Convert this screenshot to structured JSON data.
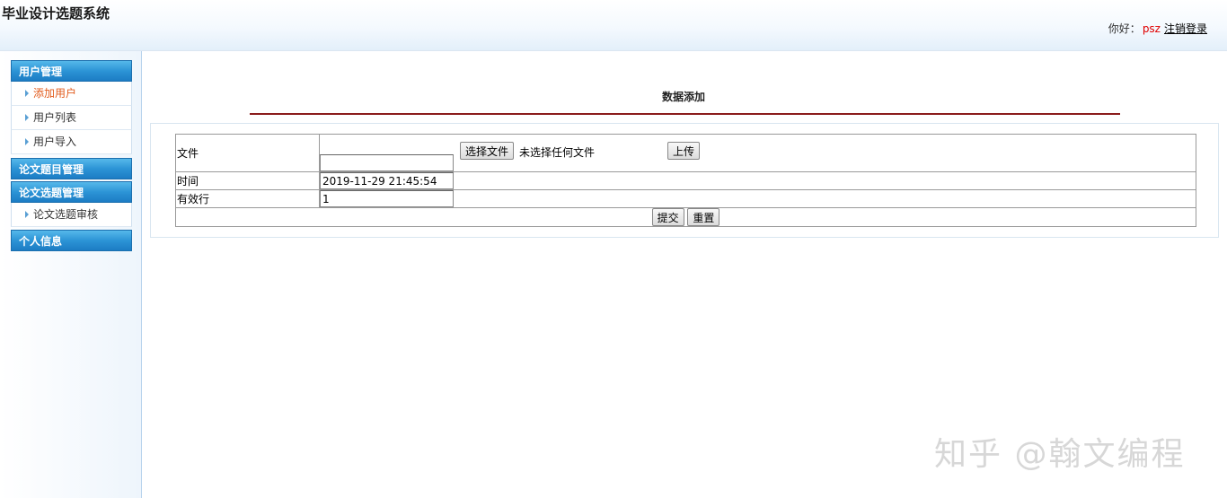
{
  "header": {
    "app_title": "毕业设计选题系统",
    "greeting": "你好：",
    "username": "psz",
    "logout": "注销登录"
  },
  "sidebar": {
    "groups": [
      {
        "title": "用户管理",
        "items": [
          "添加用户",
          "用户列表",
          "用户导入"
        ]
      },
      {
        "title": "论文题目管理",
        "items": []
      },
      {
        "title": "论文选题管理",
        "items": [
          "论文选题审核"
        ]
      },
      {
        "title": "个人信息",
        "items": []
      }
    ],
    "active_item": "添加用户"
  },
  "main": {
    "page_title": "数据添加",
    "form": {
      "file_label": "文件",
      "file_input_value": "",
      "choose_file_button": "选择文件",
      "no_file_text": "未选择任何文件",
      "upload_button": "上传",
      "time_label": "时间",
      "time_value": "2019-11-29 21:45:54",
      "valid_rows_label": "有效行",
      "valid_rows_value": "1",
      "submit_button": "提交",
      "reset_button": "重置"
    }
  },
  "watermark": "知乎 @翰文编程"
}
